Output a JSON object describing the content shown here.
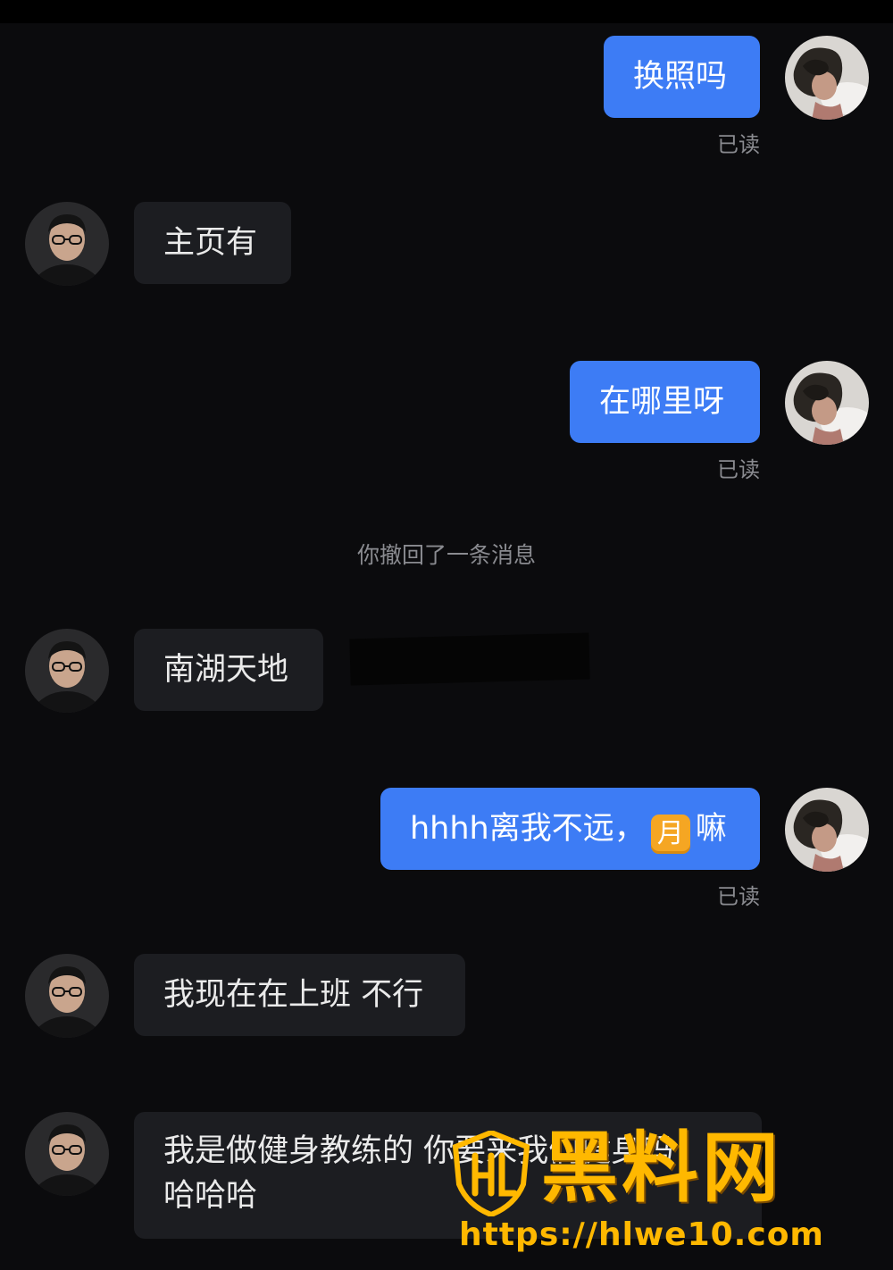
{
  "messages": [
    {
      "side": "out",
      "text": "换照吗",
      "status": "已读"
    },
    {
      "side": "in",
      "text": "主页有"
    },
    {
      "side": "out",
      "text": "在哪里呀",
      "status": "已读"
    },
    {
      "side": "in",
      "text": "南湖天地"
    },
    {
      "side": "out",
      "text_before": "hhhh离我不远，",
      "emoji": "月",
      "text_after": "嘛",
      "status": "已读"
    },
    {
      "side": "in",
      "text": "我现在在上班 不行"
    },
    {
      "side": "in",
      "line1": "我是做健身教练的 你要来我们健身吗",
      "line2": "哈哈哈"
    }
  ],
  "system_notice": "你撤回了一条消息",
  "watermark": {
    "title": "黑料网",
    "url": "https://hlwe10.com"
  },
  "colors": {
    "background": "#0b0b0d",
    "outgoing_bubble": "#3d7cf5",
    "incoming_bubble": "#1c1d21",
    "watermark": "#ffb800"
  },
  "icons": {
    "self_avatar": "user-avatar-curly-hair",
    "peer_avatar": "user-avatar-glasses",
    "watermark_logo": "hl-shield-logo"
  }
}
